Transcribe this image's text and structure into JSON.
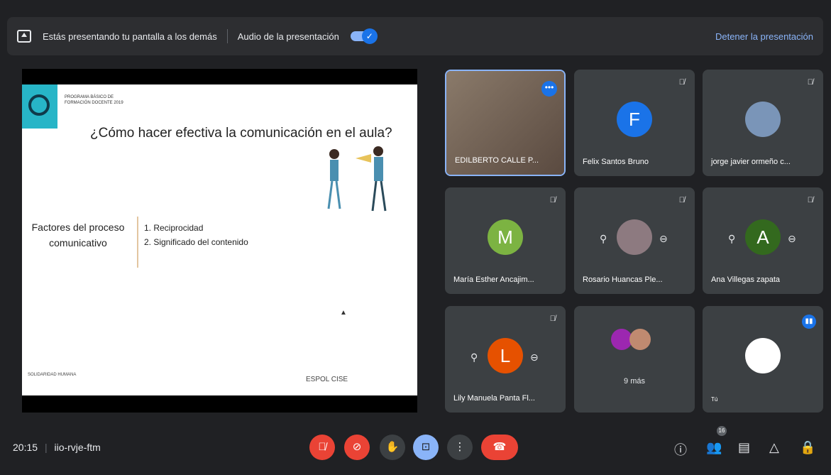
{
  "topbar": {
    "presenting_text": "Estás presentando tu pantalla a los demás",
    "audio_label": "Audio de la presentación",
    "audio_toggle_checked": "✓",
    "stop_label": "Detener la presentación"
  },
  "slide": {
    "program_text": "PROGRAMA BÁSICO DE FORMACIÓN DOCENTE 2019",
    "title": "¿Cómo hacer efectiva la comunicación en el aula?",
    "factores_label": "Factores del proceso comunicativo",
    "items": [
      "1. Reciprocidad",
      "2. Significado del contenido"
    ],
    "footer_left": "SOLIDARIDAD HUMANA",
    "footer_right": "ESPOL   CISE"
  },
  "participants": [
    {
      "name": "EDILBERTO CALLE P...",
      "initial": "",
      "color": "#6b5d50"
    },
    {
      "name": "Felix Santos Bruno",
      "initial": "F",
      "color": "#1a73e8"
    },
    {
      "name": "jorge javier ormeño c...",
      "initial": "",
      "color": "#7a95b8"
    },
    {
      "name": "María Esther Ancajim...",
      "initial": "M",
      "color": "#7cb342"
    },
    {
      "name": "Rosario Huancas Ple...",
      "initial": "",
      "color": "#8d7a80"
    },
    {
      "name": "Ana Villegas zapata",
      "initial": "A",
      "color": "#33691e"
    },
    {
      "name": "Lily Manuela Panta Fl...",
      "initial": "L",
      "color": "#e65100"
    },
    {
      "name": "9 más",
      "initial": "",
      "color": "#9c27b0"
    },
    {
      "name": "Tú",
      "initial": "",
      "color": "#ffffff"
    }
  ],
  "bottom": {
    "time": "20:15",
    "meeting_code": "iio-rvje-ftm",
    "participants_count": "16"
  },
  "icons": {
    "mic_off": "✗",
    "hand": "✋",
    "more": "⋮",
    "info": "ⓘ",
    "chat": "▤",
    "activities": "△",
    "lock": "🔒"
  }
}
